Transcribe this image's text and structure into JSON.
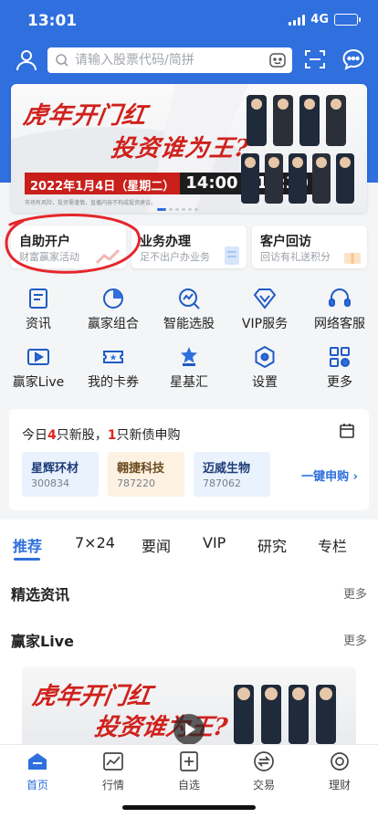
{
  "status": {
    "time": "13:01",
    "network": "4G"
  },
  "search": {
    "placeholder": "请输入股票代码/简拼"
  },
  "icons": {
    "user": "user-icon",
    "search": "search-icon",
    "voice": "voice-icon",
    "scan": "scan-icon",
    "chat": "chat-icon"
  },
  "banner": {
    "title_line1": "虎年开门红",
    "title_line2": "投资谁为王?",
    "date_text": "2022年1月4日（星期二）",
    "time_text": "14:00 - 16:30",
    "disclaimer": "市场有风险，投资需谨慎，直播内容不构成投资建议。"
  },
  "services": [
    {
      "title": "自助开户",
      "sub": "财富赢家活动"
    },
    {
      "title": "业务办理",
      "sub": "足不出户办业务"
    },
    {
      "title": "客户回访",
      "sub": "回访有礼送积分"
    }
  ],
  "grid": [
    {
      "label": "资讯",
      "icon": "news-icon"
    },
    {
      "label": "赢家组合",
      "icon": "portfolio-icon"
    },
    {
      "label": "智能选股",
      "icon": "smart-pick-icon"
    },
    {
      "label": "VIP服务",
      "icon": "vip-icon"
    },
    {
      "label": "网络客服",
      "icon": "headset-icon"
    },
    {
      "label": "赢家Live",
      "icon": "live-icon"
    },
    {
      "label": "我的卡券",
      "icon": "coupon-icon"
    },
    {
      "label": "星基汇",
      "icon": "fund-icon"
    },
    {
      "label": "设置",
      "icon": "settings-icon"
    },
    {
      "label": "更多",
      "icon": "more-grid-icon"
    }
  ],
  "ipo": {
    "prefix": "今日",
    "new_count": "4",
    "mid": "只新股，",
    "bond_count": "1",
    "suffix": "只新债申购",
    "stocks": [
      {
        "name": "星辉环材",
        "code": "300834"
      },
      {
        "name": "翱捷科技",
        "code": "787220"
      },
      {
        "name": "迈威生物",
        "code": "787062"
      }
    ],
    "action": "一键申购 ›"
  },
  "tabs": [
    "推荐",
    "7×24",
    "要闻",
    "VIP",
    "研究",
    "专栏"
  ],
  "sections": {
    "featured_title": "精选资讯",
    "featured_more": "更多",
    "live_title": "赢家Live",
    "live_more": "更多"
  },
  "tabbar": [
    {
      "label": "首页",
      "icon": "home-icon"
    },
    {
      "label": "行情",
      "icon": "market-icon"
    },
    {
      "label": "自选",
      "icon": "watchlist-icon"
    },
    {
      "label": "交易",
      "icon": "trade-icon"
    },
    {
      "label": "理财",
      "icon": "finance-icon"
    }
  ],
  "colors": {
    "primary": "#2f6fde",
    "accent_red": "#e0261f",
    "tab_active": "#2f6fde"
  }
}
